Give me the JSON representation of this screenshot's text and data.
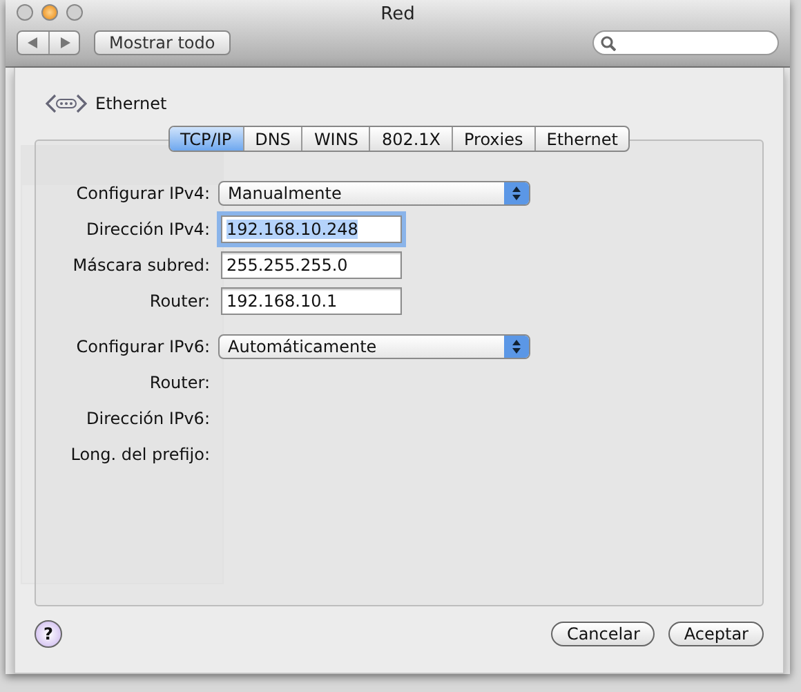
{
  "window": {
    "title": "Red",
    "show_all": "Mostrar todo"
  },
  "sheet": {
    "service": "Ethernet",
    "tabs": [
      {
        "label": "TCP/IP",
        "selected": true
      },
      {
        "label": "DNS",
        "selected": false
      },
      {
        "label": "WINS",
        "selected": false
      },
      {
        "label": "802.1X",
        "selected": false
      },
      {
        "label": "Proxies",
        "selected": false
      },
      {
        "label": "Ethernet",
        "selected": false
      }
    ],
    "sections": [
      [
        {
          "kind": "popup",
          "label": "Configurar IPv4:",
          "value": "Manualmente"
        },
        {
          "kind": "field",
          "label": "Dirección IPv4:",
          "value": "192.168.10.248",
          "focused": true
        },
        {
          "kind": "field",
          "label": "Máscara subred:",
          "value": "255.255.255.0",
          "focused": false
        },
        {
          "kind": "field",
          "label": "Router:",
          "value": "192.168.10.1",
          "focused": false
        }
      ],
      [
        {
          "kind": "popup",
          "label": "Configurar IPv6:",
          "value": "Automáticamente"
        },
        {
          "kind": "text",
          "label": "Router:"
        },
        {
          "kind": "text",
          "label": "Dirección IPv6:"
        },
        {
          "kind": "text",
          "label": "Long. del prefijo:"
        }
      ]
    ],
    "help": "?",
    "buttons": [
      "Cancelar",
      "Aceptar"
    ]
  }
}
